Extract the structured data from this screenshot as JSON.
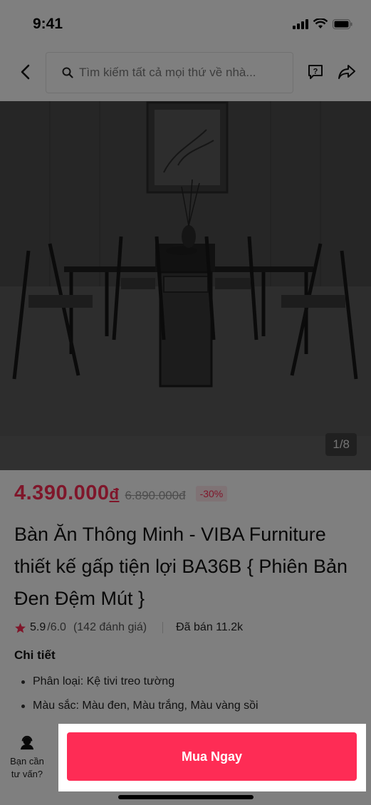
{
  "status_bar": {
    "time": "9:41"
  },
  "nav": {
    "search_placeholder": "Tìm kiếm tất cả mọi thứ về nhà..."
  },
  "product": {
    "image_counter": "1/8",
    "price": "4.390.000",
    "price_currency": "đ",
    "original_price": "6.890.000đ",
    "discount": "-30%",
    "title": "Bàn Ăn Thông Minh - VIBA Furniture thiết kế gấp tiện lợi BA36B { Phiên Bản Đen Đệm Mút }",
    "rating": "5.9",
    "rating_max": "/6.0",
    "rating_count": "(142 đánh giá)",
    "sold": "Đã bán 11.2k",
    "details_heading": "Chi tiết",
    "details": [
      "Phân loại: Kệ tivi treo tường",
      "Màu sắc: Màu đen, Màu trắng, Màu vàng sồi"
    ]
  },
  "bottom_bar": {
    "consult_label_line1": "Bạn cần",
    "consult_label_line2": "tư vấn?",
    "buy_label": "Mua Ngay"
  },
  "colors": {
    "accent": "#fe2c55",
    "overlay": "rgba(0,0,0,0.5)"
  }
}
